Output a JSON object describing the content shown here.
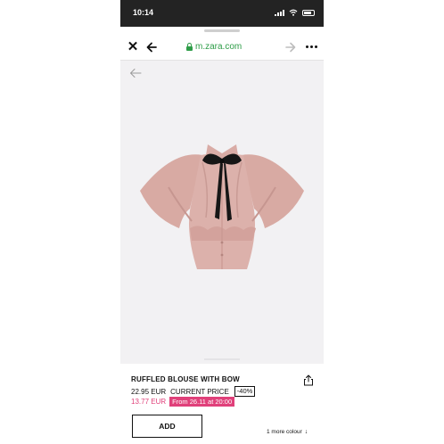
{
  "status_bar": {
    "time": "10:14"
  },
  "browser": {
    "url": "m.zara.com",
    "close_icon": "close-icon",
    "back_icon": "arrow-left-icon",
    "forward_icon": "arrow-right-icon",
    "more_icon": "more-horizontal-icon",
    "lock_icon": "lock-icon",
    "url_color": "#2e9d48"
  },
  "product": {
    "image_alt_icon": "blouse-image",
    "title": "RUFFLED BLOUSE WITH BOW",
    "original_price": "22.95 EUR",
    "current_price_label": "CURRENT PRICE",
    "discount": "-40%",
    "sale_price": "13.77 EUR",
    "promo": "From 26.11 at 20:00",
    "add_label": "ADD",
    "more_colours": "1 more colour",
    "accent_color": "#e0407a"
  }
}
